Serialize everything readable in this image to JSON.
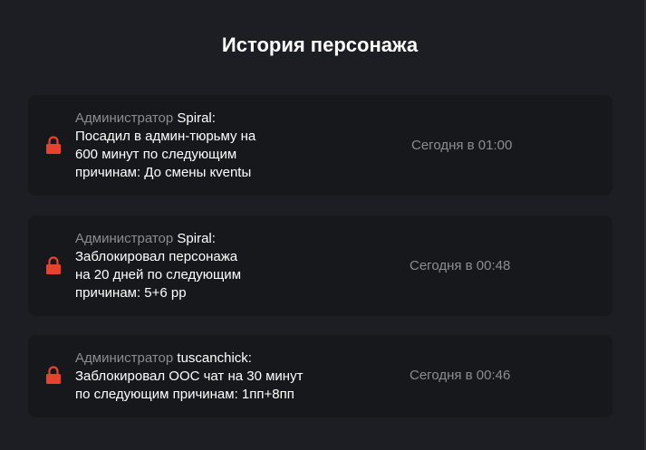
{
  "page": {
    "title": "История персонажа"
  },
  "history": [
    {
      "role": "Администратор",
      "name": "Spiral:",
      "lines": [
        "Посадил в админ-тюрьму на",
        "600 минут по следующим",
        "причинам: До смены кventы"
      ],
      "time": "Сегодня в 01:00",
      "icon": "lock-icon"
    },
    {
      "role": "Администратор",
      "name": "Spiral:",
      "lines": [
        "Заблокировал персонажа",
        "на 20 дней по следующим",
        "причинам: 5+6 рр"
      ],
      "time": "Сегодня в 00:48",
      "icon": "lock-icon"
    },
    {
      "role": "Администратор",
      "name": "tuscanchick:",
      "lines": [
        "Заблокировал ООС чат на 30 минут",
        "по следующим причинам: 1пп+8пп"
      ],
      "time": "Сегодня в 00:46",
      "icon": "lock-icon"
    }
  ],
  "colors": {
    "background": "#1d1e23",
    "card": "#17181c",
    "lock": "#e5432d",
    "muted": "#8b8c91"
  }
}
